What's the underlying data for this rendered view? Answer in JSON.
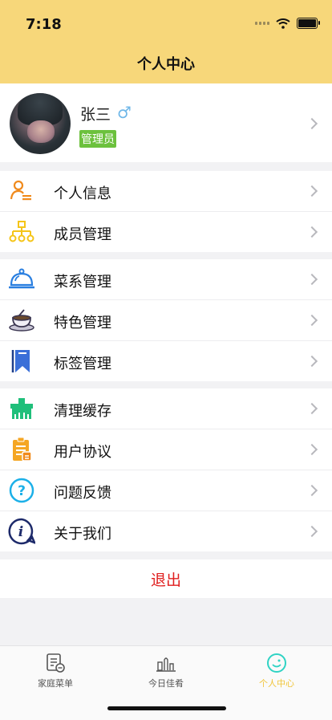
{
  "status_bar": {
    "time": "7:18"
  },
  "nav": {
    "title": "个人中心"
  },
  "profile": {
    "name": "张三",
    "gender_symbol": "♂",
    "role": "管理员"
  },
  "group1": [
    {
      "label": "个人信息",
      "icon": "user-info-icon"
    },
    {
      "label": "成员管理",
      "icon": "org-chart-icon"
    }
  ],
  "group2": [
    {
      "label": "菜系管理",
      "icon": "food-cloche-icon"
    },
    {
      "label": "特色管理",
      "icon": "coffee-cup-icon"
    },
    {
      "label": "标签管理",
      "icon": "bookmark-icon"
    }
  ],
  "group3": [
    {
      "label": "清理缓存",
      "icon": "clean-cache-icon"
    },
    {
      "label": "用户协议",
      "icon": "clipboard-icon"
    },
    {
      "label": "问题反馈",
      "icon": "question-icon"
    },
    {
      "label": "关于我们",
      "icon": "info-icon"
    }
  ],
  "logout": {
    "label": "退出"
  },
  "tabs": [
    {
      "label": "家庭菜单",
      "icon": "menu-doc-icon"
    },
    {
      "label": "今日佳肴",
      "icon": "dining-icon"
    },
    {
      "label": "个人中心",
      "icon": "smiley-icon",
      "active": true
    }
  ],
  "colors": {
    "header": "#f7d77a",
    "accent": "#f0c43a",
    "logout": "#e01e1e",
    "role_badge": "#6cc13d"
  }
}
